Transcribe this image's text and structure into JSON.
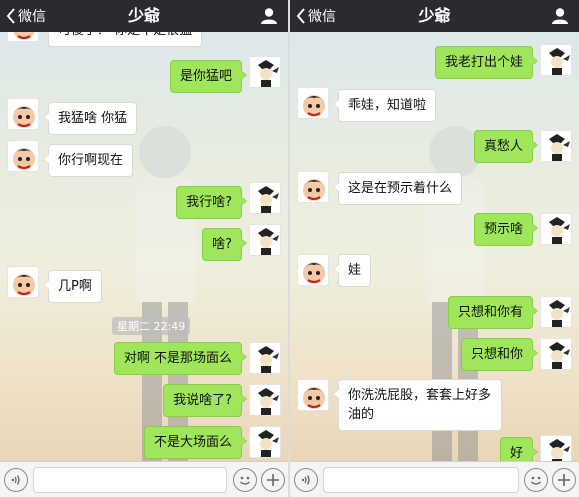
{
  "left": {
    "nav": {
      "back_label": "微信",
      "title": "少爺"
    },
    "partial_top_text": "可傻子？ 你是不是很猛",
    "timestamp": "星期二 22:49",
    "messages": [
      {
        "side": "right",
        "text": "是你猛吧"
      },
      {
        "side": "left",
        "text": "我猛啥 你猛"
      },
      {
        "side": "left",
        "text": "你行啊现在"
      },
      {
        "side": "right",
        "text": "我行啥?"
      },
      {
        "side": "right",
        "text": "啥?"
      },
      {
        "side": "left",
        "text": "几P啊"
      },
      {
        "side": "right",
        "text": "对啊  不是那场面么"
      },
      {
        "side": "right",
        "text": "我说啥了?"
      },
      {
        "side": "right",
        "text": "不是大场面么"
      }
    ]
  },
  "right": {
    "nav": {
      "back_label": "微信",
      "title": "少爺"
    },
    "messages": [
      {
        "side": "right",
        "text": "我老打出个娃"
      },
      {
        "side": "left",
        "text": "乖娃，知道啦"
      },
      {
        "side": "right",
        "text": "真愁人"
      },
      {
        "side": "left",
        "text": "这是在预示着什么"
      },
      {
        "side": "right",
        "text": "预示啥"
      },
      {
        "side": "left",
        "text": "娃"
      },
      {
        "side": "right",
        "text": "只想和你有"
      },
      {
        "side": "right",
        "text": "只想和你"
      },
      {
        "side": "left",
        "text": "你洗洗屁股，套套上好多油的"
      },
      {
        "side": "right",
        "text": "好"
      }
    ]
  },
  "icons": {
    "back": "chevron-left-icon",
    "profile": "person-icon",
    "voice": "voice-icon",
    "emoji": "emoji-icon",
    "plus": "plus-icon"
  },
  "colors": {
    "navbar": "#2b2b2f",
    "bubble_sent": "#9fe65b",
    "bubble_received": "#ffffff"
  }
}
